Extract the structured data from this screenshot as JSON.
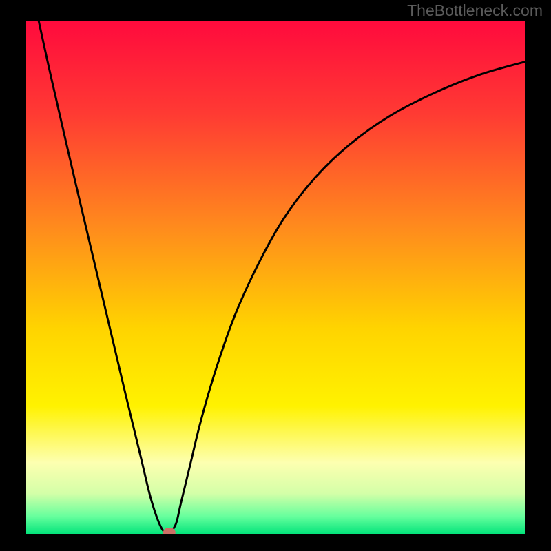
{
  "watermark": "TheBottleneck.com",
  "chart_data": {
    "type": "line",
    "title": "",
    "xlabel": "",
    "ylabel": "",
    "xlim": [
      0,
      100
    ],
    "ylim": [
      0,
      100
    ],
    "series": [
      {
        "name": "bottleneck-curve",
        "x": [
          2.5,
          5,
          10,
          15,
          20,
          23,
          25,
          27,
          28.5,
          30,
          31,
          33,
          35,
          38,
          42,
          47,
          52,
          58,
          65,
          73,
          82,
          91,
          100
        ],
        "values": [
          100,
          89,
          68,
          47.5,
          27,
          15,
          7,
          1.5,
          0.3,
          2,
          6,
          14,
          22,
          32,
          43,
          53.5,
          62,
          69.5,
          76,
          81.5,
          86,
          89.5,
          92
        ]
      }
    ],
    "marker": {
      "x": 28.7,
      "y": 0.4
    },
    "gradient_stops": [
      {
        "offset": 0,
        "color": "#ff0a3d"
      },
      {
        "offset": 18,
        "color": "#ff3a33"
      },
      {
        "offset": 40,
        "color": "#ff8a1d"
      },
      {
        "offset": 60,
        "color": "#ffd400"
      },
      {
        "offset": 75,
        "color": "#fff200"
      },
      {
        "offset": 86,
        "color": "#fdffb0"
      },
      {
        "offset": 92,
        "color": "#d4ffa8"
      },
      {
        "offset": 96.5,
        "color": "#66ff9d"
      },
      {
        "offset": 100,
        "color": "#00e37a"
      }
    ]
  }
}
